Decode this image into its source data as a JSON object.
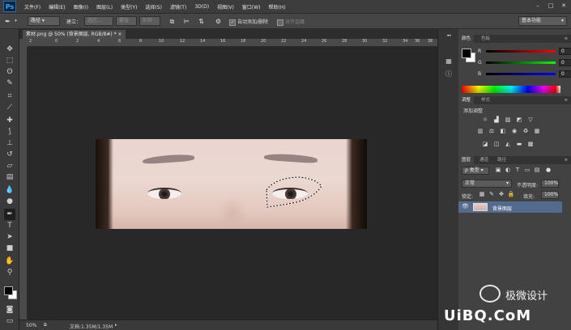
{
  "app": {
    "logo": "Ps"
  },
  "menu": [
    "文件(F)",
    "编辑(E)",
    "图像(I)",
    "图层(L)",
    "类型(Y)",
    "选择(S)",
    "滤镜(T)",
    "3D(D)",
    "视图(V)",
    "窗口(W)",
    "帮助(H)"
  ],
  "window_controls": {
    "minimize": "–",
    "restore": "□",
    "close": "✕"
  },
  "options_bar": {
    "mode_select": "路径",
    "build_label": "建立：",
    "selection_btn": "选区...",
    "mask_btn": "蒙版",
    "shape_btn": "形状",
    "auto_add_delete": "自动添加/删除",
    "align_edges": "对齐边缘",
    "workspace": "基本功能"
  },
  "document": {
    "tab_title": "素材.png @ 50% (背景图层, RGB/8#) * ×",
    "ruler_labels": [
      "2",
      "0",
      "2",
      "4",
      "6",
      "8",
      "10",
      "12",
      "14",
      "16",
      "18",
      "20",
      "22",
      "24",
      "26",
      "28",
      "30",
      "32",
      "34",
      "36",
      "38"
    ],
    "zoom": "50%",
    "doc_info": "文档:1.35M/1.35M"
  },
  "color_panel": {
    "tabs": [
      "颜色",
      "色板"
    ],
    "r_label": "R",
    "g_label": "G",
    "b_label": "B",
    "r_value": "0",
    "g_value": "0",
    "b_value": "0"
  },
  "adjust_panel": {
    "tabs": [
      "调整",
      "样式"
    ],
    "title": "添加调整"
  },
  "layers_panel": {
    "tabs": [
      "图层",
      "通道",
      "路径"
    ],
    "filter_kind": "ρ 类型",
    "blend_mode": "正常",
    "opacity_label": "不透明度:",
    "opacity_value": "100%",
    "lock_label": "锁定:",
    "fill_label": "填充:",
    "fill_value": "100%",
    "layer_name": "背景图层"
  },
  "watermark": {
    "brand": "极微设计",
    "site": "UiBQ.CoM"
  },
  "colors": {
    "accent_layer": "#556b8e",
    "panel_bg": "#424242",
    "app_bg": "#282828"
  }
}
